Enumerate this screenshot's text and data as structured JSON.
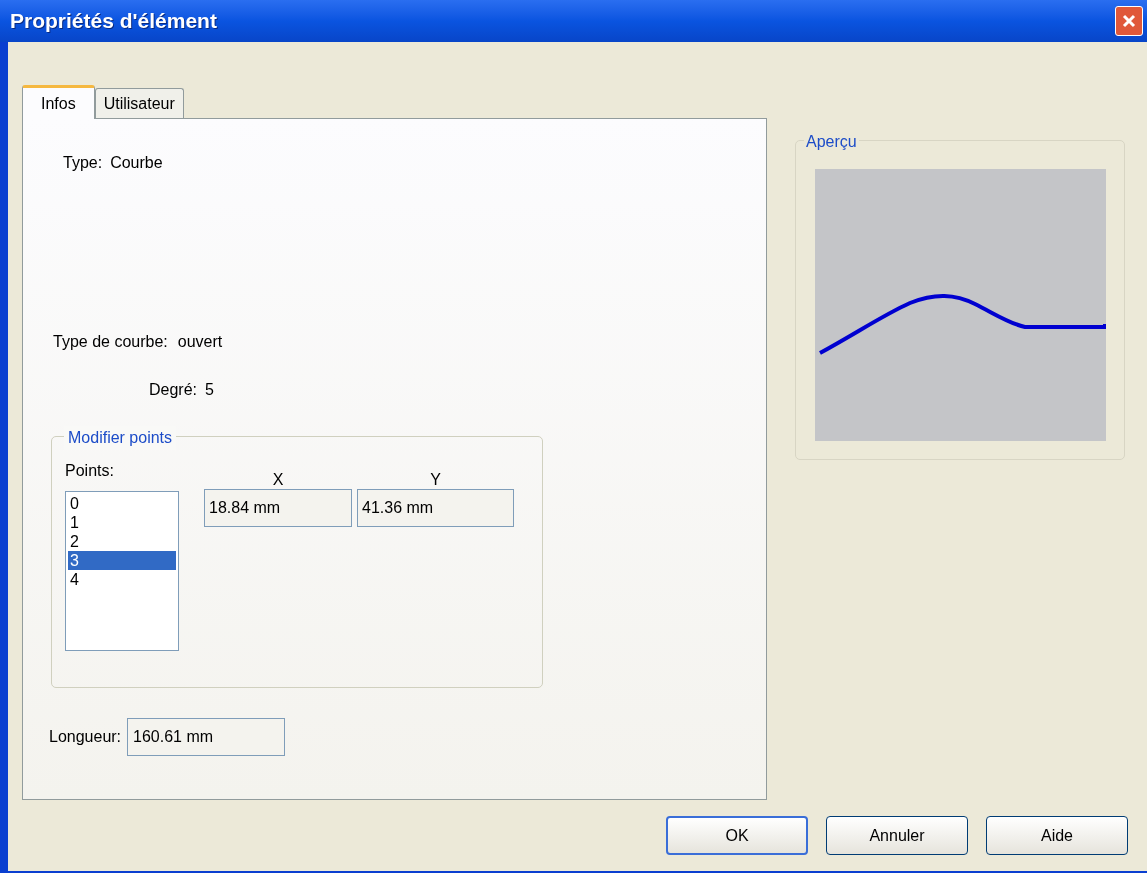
{
  "window": {
    "title": "Propriétés d'élément"
  },
  "tabs": [
    {
      "label": "Infos",
      "selected": true
    },
    {
      "label": "Utilisateur",
      "selected": false
    }
  ],
  "info": {
    "type_label": "Type:",
    "type_value": "Courbe",
    "curve_type_label": "Type de courbe:",
    "curve_type_value": "ouvert",
    "degree_label": "Degré:",
    "degree_value": "5"
  },
  "modify_points": {
    "title": "Modifier points",
    "points_label": "Points:",
    "points": [
      {
        "label": "0",
        "selected": false
      },
      {
        "label": "1",
        "selected": false
      },
      {
        "label": "2",
        "selected": false
      },
      {
        "label": "3",
        "selected": true
      },
      {
        "label": "4",
        "selected": false
      }
    ],
    "x_label": "X",
    "x_value": "18.84 mm",
    "y_label": "Y",
    "y_value": "41.36 mm"
  },
  "length": {
    "label": "Longueur:",
    "value": "160.61 mm"
  },
  "preview": {
    "title": "Aperçu"
  },
  "buttons": [
    {
      "label": "OK",
      "default": true
    },
    {
      "label": "Annuler",
      "default": false
    },
    {
      "label": "Aide",
      "default": false
    }
  ]
}
